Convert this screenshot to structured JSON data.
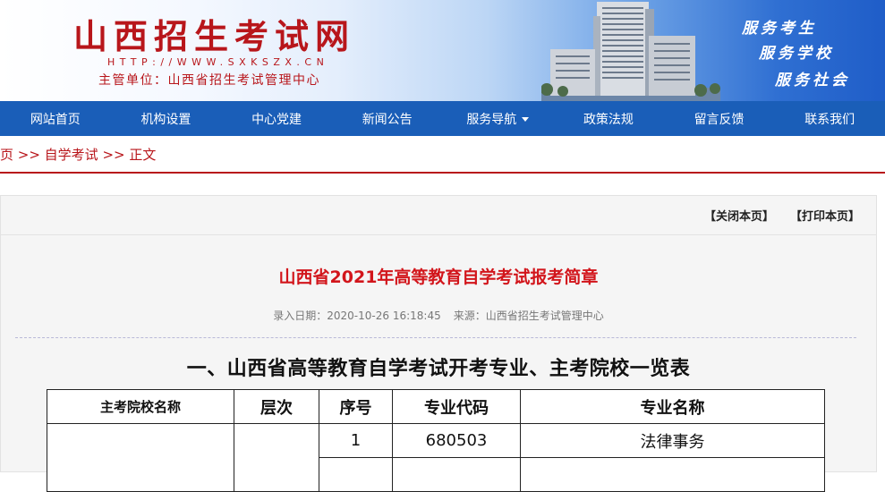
{
  "header": {
    "site_title": "山西招生考试网",
    "site_url": "HTTP://WWW.SXKSZX.CN",
    "org": "主管单位：山西省招生考试管理中心",
    "slogans": [
      "服务考生",
      "服务学校",
      "服务社会"
    ]
  },
  "nav": {
    "items": [
      {
        "label": "网站首页"
      },
      {
        "label": "机构设置"
      },
      {
        "label": "中心党建"
      },
      {
        "label": "新闻公告"
      },
      {
        "label": "服务导航"
      },
      {
        "label": "政策法规"
      },
      {
        "label": "留言反馈"
      },
      {
        "label": "联系我们"
      }
    ]
  },
  "breadcrumb": {
    "text": "页 >> 自学考试 >> 正文"
  },
  "toolbar": {
    "close_label": "【关闭本页】",
    "print_label": "【打印本页】"
  },
  "article": {
    "title": "山西省2021年高等教育自学考试报考简章",
    "date_label": "录入日期：2020-10-26 16:18:45",
    "source_label": "来源：山西省招生考试管理中心",
    "section_heading": "一、山西省高等教育自学考试开考专业、主考院校一览表"
  },
  "table": {
    "headers": [
      "主考院校名称",
      "层次",
      "序号",
      "专业代码",
      "专业名称"
    ],
    "rows": [
      [
        "",
        "",
        "1",
        "680503",
        "法律事务"
      ]
    ]
  },
  "colors": {
    "brand_red": "#b8161b",
    "nav_blue": "#1a5eb8",
    "title_red": "#d2151b"
  }
}
